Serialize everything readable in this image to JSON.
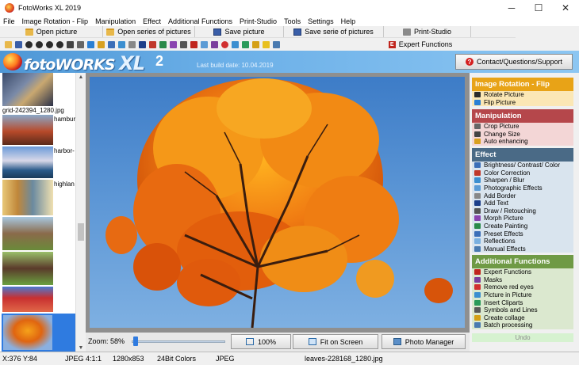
{
  "window": {
    "title": "FotoWorks XL 2019",
    "minimize": "─",
    "maximize": "☐",
    "close": "✕"
  },
  "menu": [
    "File",
    "Image Rotation - Flip",
    "Manipulation",
    "Effect",
    "Additional Functions",
    "Print-Studio",
    "Tools",
    "Settings",
    "Help"
  ],
  "toolbar": {
    "open_picture": "Open picture",
    "open_series": "Open series of pictures",
    "save_picture": "Save picture",
    "save_series": "Save serie of pictures",
    "print_studio": "Print-Studio",
    "expert_functions": "Expert Functions"
  },
  "banner": {
    "logo_foto": "foto",
    "logo_works": "WORKS",
    "logo_xl": "XL",
    "logo_num": "2",
    "build_date": "Last build date:  10.04.2019",
    "support": "Contact/Questions/Support"
  },
  "thumbnails": [
    {
      "label": "grid-242394_1280.jpg"
    },
    {
      "label": "hambur"
    },
    {
      "label": "harbor-"
    },
    {
      "label": "highlan"
    },
    {
      "label": ""
    },
    {
      "label": ""
    },
    {
      "label": ""
    },
    {
      "label": ""
    }
  ],
  "viewer": {
    "zoom": "Zoom: 58%",
    "btn_100": "100%",
    "btn_fit": "Fit on Screen",
    "btn_manager": "Photo Manager"
  },
  "panel": {
    "sections": [
      {
        "title": "Image Rotation - Flip",
        "color": "#e8a317",
        "bg": "#fbe7b5",
        "items": [
          "Rotate Picture",
          "Flip Picture"
        ]
      },
      {
        "title": "Manipulation",
        "color": "#b5474b",
        "bg": "#f3d6d6",
        "items": [
          "Crop Picture",
          "Change Size",
          "Auto enhancing"
        ]
      },
      {
        "title": "Effect",
        "color": "#4a6a86",
        "bg": "#d9e4ee",
        "items": [
          "Brightness/ Contrast/ Color",
          "Color Correction",
          "Sharpen / Blur",
          "Photographic Effects",
          "Add Border",
          "Add Text",
          "Draw / Retouching",
          "Morph Picture",
          "Create Painting",
          "Preset Effects",
          "Reflections",
          "Manual Effects"
        ]
      },
      {
        "title": "Additional Functions",
        "color": "#6f9a45",
        "bg": "#dbe8cf",
        "items": [
          "Expert Functions",
          "Masks",
          "Remove red eyes",
          "Picture in Picture",
          "Insert Cliparts",
          "Symbols and Lines",
          "Create collage",
          "Batch processing"
        ]
      }
    ],
    "undo": "Undo"
  },
  "status": {
    "coords": "X:376 Y:84",
    "format": "JPEG",
    "ratio": "4:1:1",
    "size": "1280x853",
    "colors": "24Bit Colors",
    "format2": "JPEG",
    "filename": "leaves-228168_1280.jpg"
  }
}
